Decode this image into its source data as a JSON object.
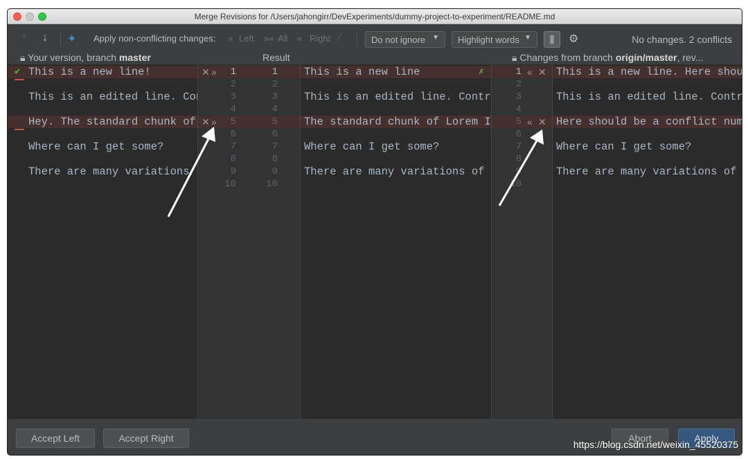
{
  "window": {
    "title": "Merge Revisions for /Users/jahongirr/DevExperiments/dummy-project-to-experiment/README.md"
  },
  "toolbar": {
    "apply_label": "Apply non-conflicting changes:",
    "left_label": "Left",
    "all_label": "All",
    "right_label": "Right",
    "ignore_dropdown": "Do not ignore",
    "highlight_dropdown": "Highlight words",
    "status": "No changes. 2 conflicts"
  },
  "headers": {
    "left_prefix": "Your version, branch ",
    "left_branch": "master",
    "middle": "Result",
    "right_prefix": "Changes from branch ",
    "right_branch": "origin/master",
    "right_suffix": ", rev..."
  },
  "left_lines": [
    "This is a new line!",
    "This is an edited line. Con",
    "Hey. The standard chunk of",
    "Where can I get some?",
    "There are many variations"
  ],
  "mid_lines": [
    "This is a new line",
    "This is an edited line. Contra",
    "The standard chunk of Lorem Ip",
    "Where can I get some?",
    "There are many variations of p"
  ],
  "right_lines": [
    "This is a new line. Here shou",
    "This is an edited line. Contr",
    "Here should be a conflict num",
    "Where can I get some?",
    "There are many variations of"
  ],
  "line_numbers": [
    "1",
    "2",
    "3",
    "4",
    "5",
    "6",
    "7",
    "8",
    "9",
    "10"
  ],
  "right_line_numbers": [
    "1",
    "2",
    "3",
    "4",
    "5",
    "6",
    "7",
    "8",
    "9",
    "10"
  ],
  "bottom": {
    "accept_left": "Accept Left",
    "accept_right": "Accept Right",
    "abort": "Abort",
    "apply": "Apply"
  },
  "watermark": "https://blog.csdn.net/weixin_45520375",
  "colors": {
    "conflict_bg": "#45302e",
    "editor_bg": "#2b2b2b",
    "accent": "#365880"
  }
}
